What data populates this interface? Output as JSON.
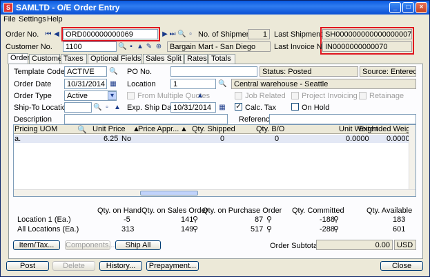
{
  "window": {
    "title": "SAMLTD - O/E Order Entry"
  },
  "menu": [
    "File",
    "Settings",
    "Help"
  ],
  "header": {
    "order_no_label": "Order No.",
    "order_no": "ORD000000000069",
    "num_shipments_label": "No. of Shipments",
    "num_shipments": "1",
    "last_shipment_label": "Last Shipment No.",
    "last_shipment": "SH0000000000000000071",
    "customer_no_label": "Customer No.",
    "customer_no": "1100",
    "customer_name": "Bargain Mart - San Diego",
    "last_invoice_label": "Last Invoice No.",
    "last_invoice": "IN0000000000070"
  },
  "tabs": [
    "Order",
    "Customer",
    "Taxes",
    "Optional Fields",
    "Sales Split",
    "Rates",
    "Totals"
  ],
  "order": {
    "template_code_label": "Template Code",
    "template_code": "ACTIVE",
    "po_no_label": "PO No.",
    "po_no": "",
    "status": "Status: Posted",
    "source": "Source: Entered",
    "order_date_label": "Order Date",
    "order_date": "10/31/2014",
    "location_label": "Location",
    "location": "1",
    "location_desc": "Central warehouse - Seattle",
    "order_type_label": "Order Type",
    "order_type": "Active",
    "from_multiple_quotes_label": "From Multiple Quotes",
    "job_related_label": "Job Related",
    "project_invoicing_label": "Project Invoicing",
    "retainage_label": "Retainage",
    "ship_to_label": "Ship-To Location",
    "ship_to": "",
    "exp_ship_date_label": "Exp. Ship Date",
    "exp_ship_date": "10/31/2014",
    "calc_tax_label": "Calc. Tax",
    "calc_tax_checked": true,
    "on_hold_label": "On Hold",
    "description_label": "Description",
    "description": "",
    "reference_label": "Reference",
    "reference": ""
  },
  "grid": {
    "columns": [
      "Pricing UOM",
      "Unit Price",
      "Price Appr...",
      "Qty. Shipped",
      "Qty. B/O",
      "Unit Weight",
      "Extended Weight"
    ],
    "rows": [
      {
        "uom": "a.",
        "unit_price": "6.25",
        "price_appr": "No",
        "qty_shipped": "0",
        "qty_bo": "0",
        "unit_weight": "0.0000",
        "ext_weight": "0.0000"
      }
    ]
  },
  "summary": {
    "headers": [
      "Qty. on Hand",
      "Qty. on Sales Order",
      "Qty. on Purchase Order",
      "Qty. Committed",
      "Qty. Available"
    ],
    "rows": [
      {
        "label": "Location  1 (Ea.)",
        "on_hand": "-5",
        "on_so": "141",
        "on_po": "87",
        "committed": "-188",
        "available": "183"
      },
      {
        "label": "All Locations (Ea.)",
        "on_hand": "313",
        "on_so": "149",
        "on_po": "517",
        "committed": "-288",
        "available": "601"
      }
    ]
  },
  "actions": {
    "item_tax": "Item/Tax...",
    "components": "Components...",
    "ship_all": "Ship All",
    "order_subtotal_label": "Order Subtotal",
    "order_subtotal": "0.00",
    "currency": "USD"
  },
  "footer": {
    "post": "Post",
    "delete": "Delete",
    "history": "History...",
    "prepayment": "Prepayment...",
    "close": "Close"
  },
  "colors": {
    "highlight_box": "#e0141e",
    "titlebar": "#0a5ae0"
  }
}
